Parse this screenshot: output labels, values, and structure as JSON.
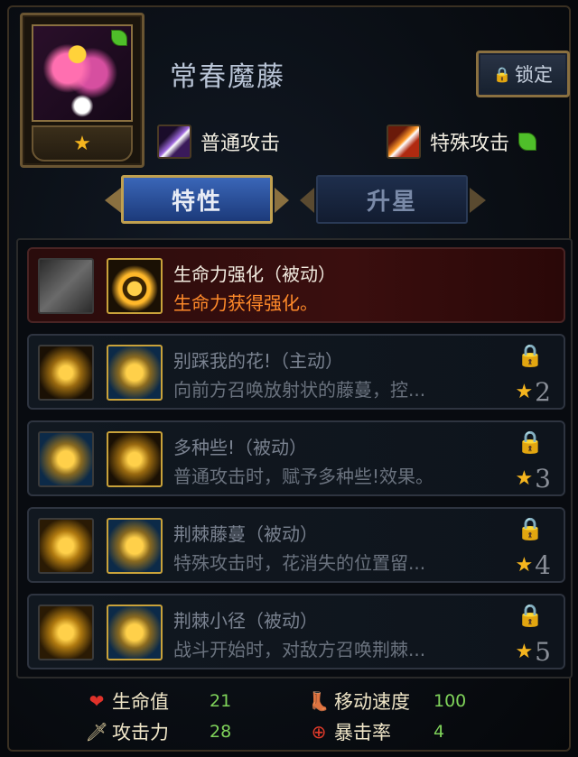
{
  "character": {
    "name": "常春魔藤",
    "stars": "★",
    "lock_label": "锁定"
  },
  "attacks": {
    "normal": "普通攻击",
    "special": "特殊攻击"
  },
  "tabs": [
    {
      "label": "特性",
      "active": true
    },
    {
      "label": "升星",
      "active": false
    }
  ],
  "traits": [
    {
      "name": "生命力强化（被动）",
      "desc": "生命力获得强化。",
      "unlocked": true,
      "star": "",
      "icon1": "gray-wing-icon",
      "icon2": "heart-flame-icon"
    },
    {
      "name": "别踩我的花!（主动）",
      "desc": "向前方召唤放射状的藤蔓，控...",
      "unlocked": false,
      "star": "2",
      "icon1": "vine-spiral-icon",
      "icon2": "flower-emblem-icon"
    },
    {
      "name": "多种些!（被动）",
      "desc": "普通攻击时，赋予多种些!效果。",
      "unlocked": false,
      "star": "3",
      "icon1": "sprout-icon",
      "icon2": "rose-icon"
    },
    {
      "name": "荆棘藤蔓（被动）",
      "desc": "特殊攻击时，花消失的位置留...",
      "unlocked": false,
      "star": "4",
      "icon1": "thorn-slash-icon",
      "icon2": "thorn-vine-icon"
    },
    {
      "name": "荆棘小径（被动）",
      "desc": "战斗开始时，对敌方召唤荆棘...",
      "unlocked": false,
      "star": "5",
      "icon1": "thorn-flame-icon",
      "icon2": "thorn-bloom-icon"
    }
  ],
  "stats": {
    "hp_label": "生命值",
    "hp": "21",
    "atk_label": "攻击力",
    "atk": "28",
    "speed_label": "移动速度",
    "speed": "100",
    "crit_label": "暴击率",
    "crit": "4"
  },
  "icons": {
    "star": "★",
    "lock": "🔒",
    "heart": "❤",
    "sword": "🗡",
    "boot": "👢",
    "crosshair": "⊕"
  },
  "colors": {
    "accent_gold": "#c0a050",
    "star": "#f5b51e",
    "active_desc": "#ff8a2a",
    "stat_value": "#7fd35a",
    "tab_active": "#2a56a8"
  }
}
